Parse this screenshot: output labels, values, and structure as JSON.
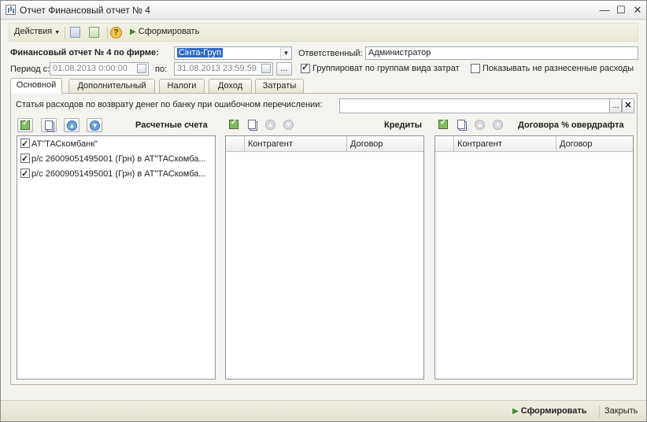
{
  "window": {
    "title": "Отчет  Финансовый отчет № 4",
    "minimize": "—",
    "maximize": "☐",
    "close": "✕"
  },
  "toolbar": {
    "actions_label": "Действия",
    "help_glyph": "?",
    "generate_label": "Сформировать"
  },
  "form": {
    "company_label": "Финансовый отчет № 4 по фирме:",
    "company_value": "Сінта-Груп",
    "responsible_label": "Ответственный:",
    "responsible_value": "Администратор",
    "period_from_label": "Период с:",
    "period_from_value": "01.08.2013  0:00:00",
    "period_to_label": "по:",
    "period_to_value": "31.08.2013 23:59:59",
    "period_button": "...",
    "group_checkbox_label": "Группироват по группам вида затрат",
    "group_checkbox_checked": true,
    "show_unallocated_label": "Показывать не разнесенные расходы",
    "show_unallocated_checked": false
  },
  "tabs": [
    {
      "label": "Основной",
      "active": true
    },
    {
      "label": "Дополнительный",
      "active": false
    },
    {
      "label": "Налоги",
      "active": false
    },
    {
      "label": "Доход",
      "active": false
    },
    {
      "label": "Затраты",
      "active": false
    }
  ],
  "main": {
    "expense_label": "Статья расходов по возврату денег по банку при ошибочном перечислении:",
    "expense_value": "",
    "expense_select_button": "...",
    "expense_clear_button": "✕",
    "accounts": {
      "title": "Расчетные счета",
      "items": [
        {
          "label": "АТ\"ТАСкомбанк\"",
          "checked": true
        },
        {
          "label": "р/с 26009051495001 (Грн) в АТ\"ТАСкомба...",
          "checked": true
        },
        {
          "label": "р/с 26009051495001 (Грн) в АТ\"ТАСкомба...",
          "checked": true
        }
      ]
    },
    "credits": {
      "title": "Кредиты",
      "columns": [
        "Контрагент",
        "Договор"
      ]
    },
    "overdraft": {
      "title": "Договора % овердрафта",
      "columns": [
        "Контрагент",
        "Договор"
      ]
    }
  },
  "icons": {
    "up_arrow": "▲",
    "down_arrow": "▼",
    "dropdown": "▼"
  },
  "statusbar": {
    "generate_label": "Сформировать",
    "close_label": "Закрыть"
  }
}
